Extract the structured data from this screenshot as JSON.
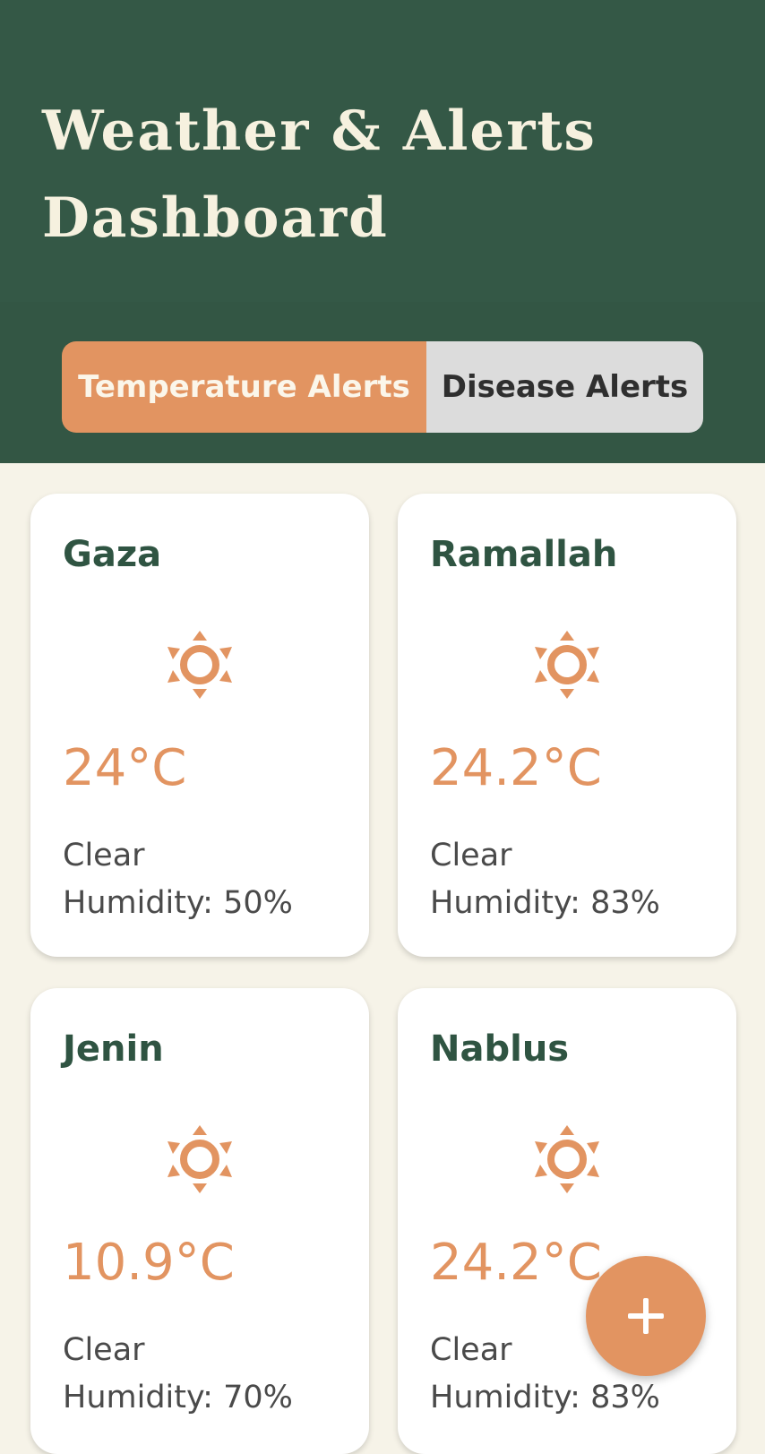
{
  "app": {
    "title": "Weather & Alerts Dashboard"
  },
  "tabs": [
    {
      "label": "Temperature Alerts",
      "active": true
    },
    {
      "label": "Disease Alerts",
      "active": false
    }
  ],
  "cards": [
    {
      "city": "Gaza",
      "icon": "sun-icon",
      "temperature": "24°C",
      "condition": "Clear",
      "humidity": "Humidity: 50%"
    },
    {
      "city": "Ramallah",
      "icon": "sun-icon",
      "temperature": "24.2°C",
      "condition": "Clear",
      "humidity": "Humidity: 83%"
    },
    {
      "city": "Jenin",
      "icon": "sun-icon",
      "temperature": "10.9°C",
      "condition": "Clear",
      "humidity": "Humidity: 70%"
    },
    {
      "city": "Nablus",
      "icon": "sun-icon",
      "temperature": "24.2°C",
      "condition": "Clear",
      "humidity": "Humidity: 83%"
    }
  ],
  "fab": {
    "icon": "plus-icon"
  },
  "colors": {
    "header": "#345846",
    "accent": "#e29461",
    "background": "#f6f3e8",
    "card": "#ffffff",
    "city_text": "#2f5442",
    "inactive_tab": "#dcdcdc"
  }
}
